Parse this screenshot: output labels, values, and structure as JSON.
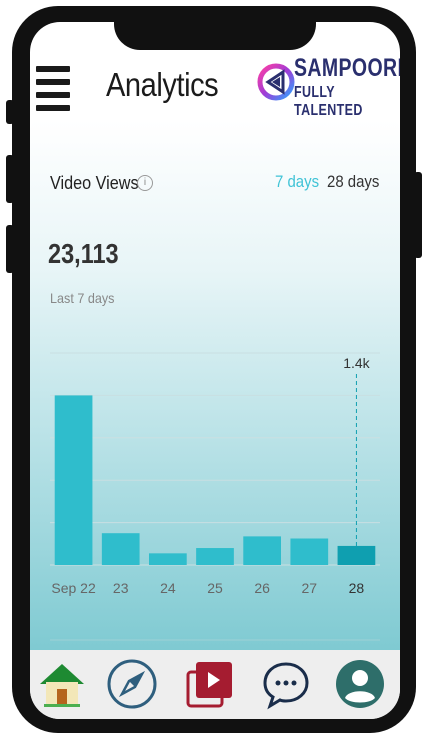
{
  "header": {
    "title": "Analytics",
    "logo_line1": "SAMPOORN",
    "logo_line2": "FULLY TALENTED"
  },
  "card": {
    "title": "Video Views",
    "tabs": [
      "7 days",
      "28 days"
    ],
    "active_tab": "7 days",
    "total": "23,113",
    "period": "Last 7 days"
  },
  "chart_data": {
    "type": "bar",
    "categories": [
      "Sep 22",
      "23",
      "24",
      "25",
      "26",
      "27",
      "28"
    ],
    "values": [
      8000,
      1500,
      550,
      800,
      1350,
      1250,
      900
    ],
    "annotations": [
      {
        "category": "28",
        "label": "1.4k"
      }
    ],
    "highlighted": "28",
    "grid": true,
    "colors": {
      "bar": "#2fbdcc",
      "highlight": "#0f9fb0"
    }
  },
  "bottom_nav": {
    "items": [
      "home-icon",
      "compass-icon",
      "video-library-icon",
      "chat-icon",
      "profile-icon"
    ]
  },
  "colors": {
    "accent": "#3fc3d6",
    "brand": "#2a2f6e"
  }
}
